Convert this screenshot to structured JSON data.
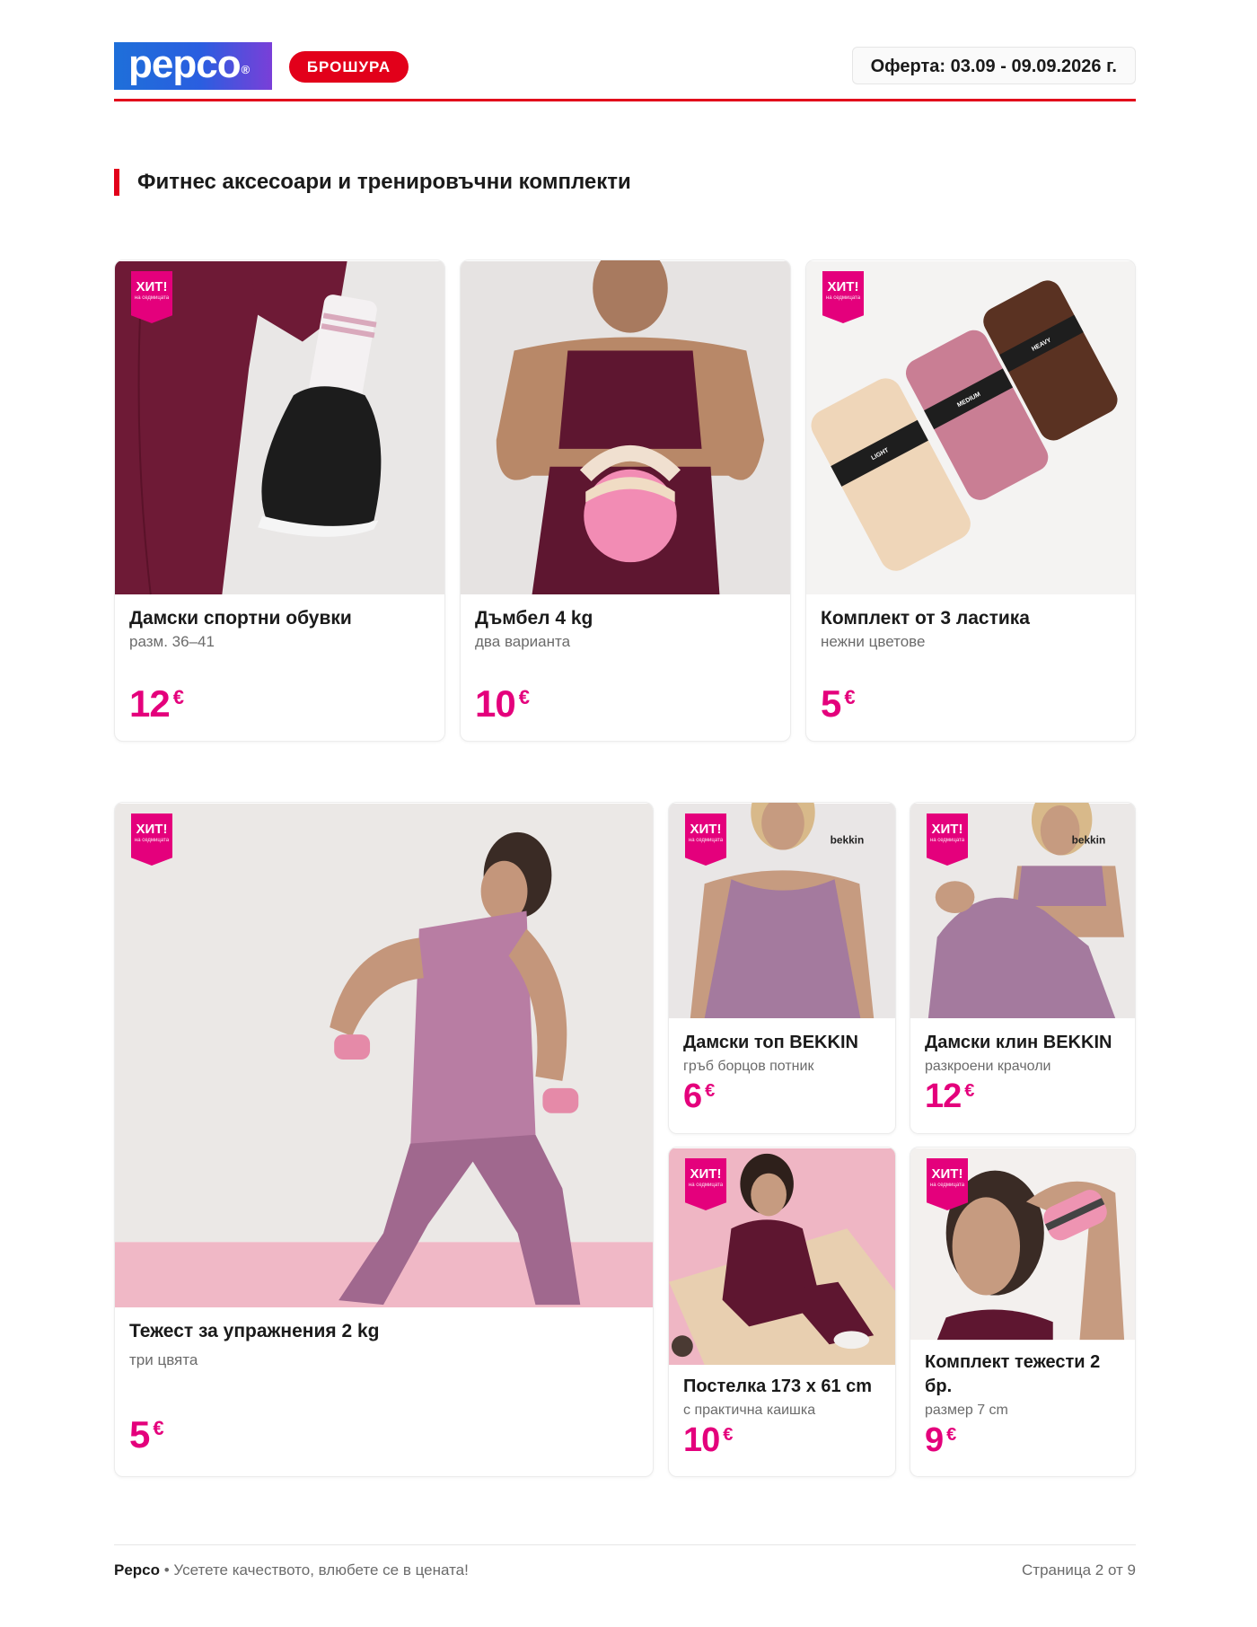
{
  "header": {
    "logo_text": "pepco",
    "logo_mark": "®",
    "badge_label": "БРОШУРА",
    "offer_label": "Оферта: 03.09 - 09.09.2026 г."
  },
  "section": {
    "title": "Фитнес аксесоари и тренировъчни комплекти"
  },
  "hit_badge": {
    "top": "ХИТ!",
    "bottom": "на седмицата"
  },
  "currency": "€",
  "products": [
    {
      "name": "Дамски спортни обувки",
      "sub": "разм. 36–41",
      "price": "12",
      "hit": true,
      "image": "sneaker-leggings-photo"
    },
    {
      "name": "Дъмбел 4 kg",
      "sub": "два варианта",
      "price": "10",
      "hit": false,
      "image": "kettlebell-photo"
    },
    {
      "name": "Комплект от 3 ластика",
      "sub": "нежни цветове",
      "price": "5",
      "hit": true,
      "image": "resistance-bands-photo"
    },
    {
      "name": "Тежест за упражнения 2 kg",
      "sub": "три цвята",
      "price": "5",
      "hit": true,
      "image": "dumbbell-workout-photo"
    },
    {
      "name": "Дамски топ BEKKIN",
      "sub": "гръб борцов потник",
      "price": "6",
      "hit": true,
      "image": "tank-top-photo"
    },
    {
      "name": "Дамски клин BEKKIN",
      "sub": "разкроени крачоли",
      "price": "12",
      "hit": true,
      "image": "flared-leggings-photo"
    },
    {
      "name": "Постелка 173 x 61 cm",
      "sub": "с практична каишка",
      "price": "10",
      "hit": true,
      "image": "yoga-mat-photo"
    },
    {
      "name": "Комплект тежести 2 бр.",
      "sub": "размер 7 cm",
      "price": "9",
      "hit": true,
      "image": "wrist-weights-photo"
    }
  ],
  "brand_labels": {
    "bekkin": "bekkin",
    "band_light": "LIGHT",
    "band_medium": "MEDIUM",
    "band_heavy": "HEAVY"
  },
  "footer": {
    "brand": "Pepco",
    "tagline": " • Усетете качеството, влюбете се в цената!",
    "page": "Страница 2 от 9"
  },
  "colors": {
    "accent_red": "#e2001a",
    "price_pink": "#e4007c",
    "logo_blue": "#1e6fd9"
  }
}
